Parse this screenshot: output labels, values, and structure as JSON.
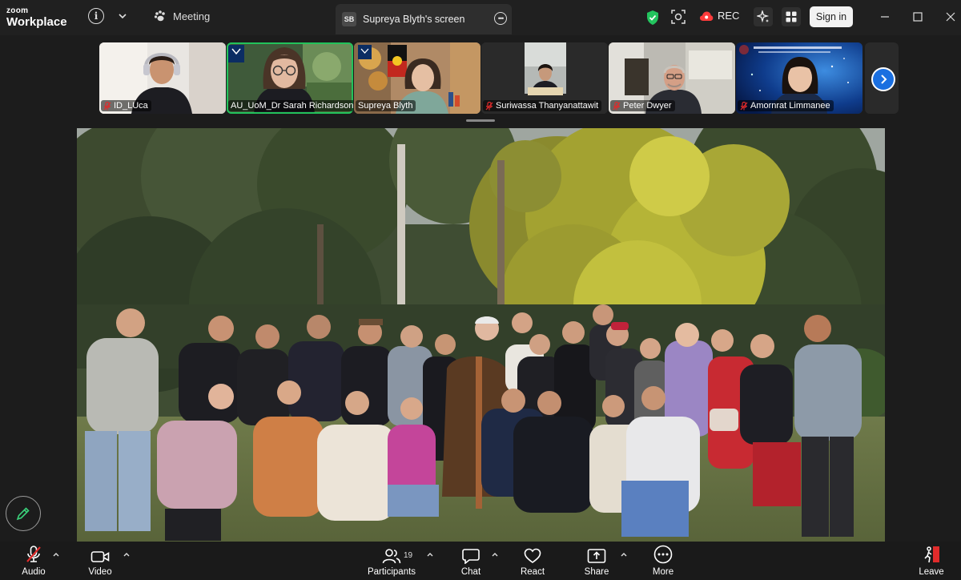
{
  "titlebar": {
    "brand_top": "zoom",
    "brand_bottom": "Workplace",
    "meeting_label": "Meeting",
    "share_tab": {
      "initials": "SB",
      "title": "Supreya Blyth's screen"
    },
    "rec_label": "REC",
    "signin_label": "Sign in"
  },
  "participants_strip": [
    {
      "name": "ID_LUca",
      "muted": true
    },
    {
      "name": "AU_UoM_Dr Sarah Richardson",
      "muted": false,
      "active": true
    },
    {
      "name": "Supreya Blyth",
      "muted": false
    },
    {
      "name": "Suriwassa Thanyanattawit",
      "muted": true
    },
    {
      "name": "Peter Dwyer",
      "muted": true
    },
    {
      "name": "Amornrat Limmanee",
      "muted": true
    }
  ],
  "toolbar": {
    "audio": "Audio",
    "video": "Video",
    "participants": "Participants",
    "participants_count": "19",
    "chat": "Chat",
    "react": "React",
    "share": "Share",
    "more": "More",
    "leave": "Leave"
  },
  "colors": {
    "accent_blue": "#1a6fe0",
    "active_green": "#22c25b",
    "muted_red": "#e02b2b",
    "shield_green": "#23c45e"
  }
}
